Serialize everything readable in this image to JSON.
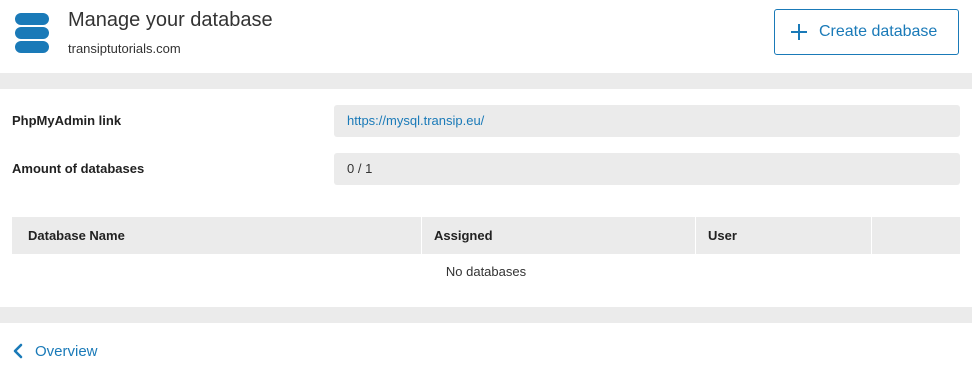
{
  "header": {
    "icon": "database-icon",
    "title": "Manage your database",
    "subtitle": "transiptutorials.com",
    "create_button": {
      "icon": "plus-icon",
      "label": "Create database"
    }
  },
  "details": {
    "phpmyadmin": {
      "label": "PhpMyAdmin link",
      "value": "https://mysql.transip.eu/"
    },
    "amount": {
      "label": "Amount of databases",
      "value": "0 / 1"
    }
  },
  "table": {
    "columns": [
      "Database Name",
      "Assigned",
      "User",
      ""
    ],
    "empty_message": "No databases"
  },
  "footer": {
    "back_icon": "chevron-left-icon",
    "back_label": "Overview"
  },
  "colors": {
    "accent": "#1a7ab8",
    "band": "#ebebeb",
    "field_bg": "#ebebeb"
  }
}
